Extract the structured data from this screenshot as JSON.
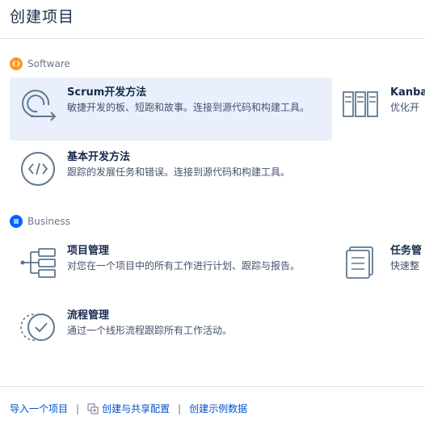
{
  "header": {
    "title": "创建项目"
  },
  "sections": [
    {
      "label": "Software",
      "icon": "code-icon",
      "color": "#ff991f"
    },
    {
      "label": "Business",
      "icon": "list-icon",
      "color": "#0065ff"
    }
  ],
  "cards": {
    "scrum": {
      "name": "Scrum开发方法",
      "desc": "敏捷开发的板、短跑和故事。连接到源代码和构建工具。",
      "icon": "scrum-cycle-icon"
    },
    "kanban": {
      "name": "Kanban",
      "desc": "优化开",
      "icon": "kanban-board-icon"
    },
    "basic": {
      "name": "基本开发方法",
      "desc": "跟踪的发展任务和错误。连接到源代码和构建工具。",
      "icon": "code-brackets-icon"
    },
    "project": {
      "name": "项目管理",
      "desc": "对您在一个项目中的所有工作进行计划、跟踪与报告。",
      "icon": "project-tree-icon"
    },
    "task": {
      "name": "任务管",
      "desc": "快速整",
      "icon": "task-list-icon"
    },
    "process": {
      "name": "流程管理",
      "desc": "通过一个线形流程跟踪所有工作活动。",
      "icon": "process-check-icon"
    }
  },
  "footer": {
    "import": "导入一个项目",
    "share_config": "创建与共享配置",
    "sample_data": "创建示例数据",
    "separator": "|"
  },
  "colors": {
    "selected_bg": "#e9f0fb",
    "link": "#0052cc",
    "icon_stroke": "#5e7891"
  }
}
